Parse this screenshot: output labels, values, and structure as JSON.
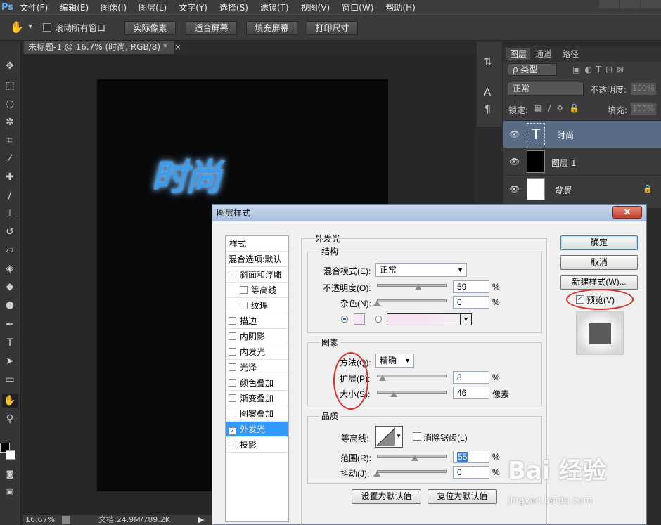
{
  "app": {
    "logo": "Ps"
  },
  "menu": [
    "文件(F)",
    "编辑(E)",
    "图像(I)",
    "图层(L)",
    "文字(Y)",
    "选择(S)",
    "滤镜(T)",
    "视图(V)",
    "窗口(W)",
    "帮助(H)"
  ],
  "options": {
    "scroll_all_label": "滚动所有窗口",
    "actual_pixels": "实际像素",
    "fit_screen": "适合屏幕",
    "fill_screen": "填充屏幕",
    "print_size": "打印尺寸"
  },
  "document": {
    "tab_title": "未标题-1 @ 16.7% (时尚, RGB/8) *",
    "tab_close": "×",
    "canvas_text": "时尚",
    "status_zoom": "16.67%",
    "status_doc": "文档:24.9M/789.2K"
  },
  "layers_panel": {
    "tabs": [
      "图层",
      "通道",
      "路径"
    ],
    "filter_label": "ρ 类型",
    "blend_mode": "正常",
    "opacity_label": "不透明度:",
    "opacity_value": "100%",
    "lock_label": "锁定:",
    "fill_label": "填充:",
    "fill_value": "100%",
    "layers": [
      {
        "name": "时尚",
        "thumb": "T"
      },
      {
        "name": "图层 1",
        "thumb": ""
      },
      {
        "name": "背景",
        "thumb": ""
      }
    ]
  },
  "dialog": {
    "title": "图层样式",
    "close": "✕",
    "styles_header": "样式",
    "blend_options": "混合选项:默认",
    "style_items": [
      {
        "label": "斜面和浮雕",
        "checked": false,
        "indent": false
      },
      {
        "label": "等高线",
        "checked": false,
        "indent": true
      },
      {
        "label": "纹理",
        "checked": false,
        "indent": true
      },
      {
        "label": "描边",
        "checked": false,
        "indent": false
      },
      {
        "label": "内阴影",
        "checked": false,
        "indent": false
      },
      {
        "label": "内发光",
        "checked": false,
        "indent": false
      },
      {
        "label": "光泽",
        "checked": false,
        "indent": false
      },
      {
        "label": "颜色叠加",
        "checked": false,
        "indent": false
      },
      {
        "label": "渐变叠加",
        "checked": false,
        "indent": false
      },
      {
        "label": "图案叠加",
        "checked": false,
        "indent": false
      },
      {
        "label": "外发光",
        "checked": true,
        "indent": false
      },
      {
        "label": "投影",
        "checked": false,
        "indent": false
      }
    ],
    "outer_glow_title": "外发光",
    "structure": {
      "title": "结构",
      "blend_mode_label": "混合模式(E):",
      "blend_mode_value": "正常",
      "opacity_label": "不透明度(O):",
      "opacity_value": "59",
      "noise_label": "杂色(N):",
      "noise_value": "0",
      "percent": "%"
    },
    "elements": {
      "title": "图素",
      "method_label": "方法(Q):",
      "method_value": "精确",
      "spread_label": "扩展(P):",
      "spread_value": "8",
      "size_label": "大小(S):",
      "size_value": "46",
      "size_unit": "像素",
      "percent": "%"
    },
    "quality": {
      "title": "品质",
      "contour_label": "等高线:",
      "antialias_label": "消除锯齿(L)",
      "range_label": "范围(R):",
      "range_value": "55",
      "jitter_label": "抖动(J):",
      "jitter_value": "0",
      "percent": "%"
    },
    "set_default": "设置为默认值",
    "reset_default": "复位为默认值",
    "ok": "确定",
    "cancel": "取消",
    "new_style": "新建样式(W)...",
    "preview_label": "预览(V)",
    "preview_checked": true
  },
  "watermark": {
    "brand": "Bai 经验",
    "url": "jingyan.baidu.com"
  }
}
